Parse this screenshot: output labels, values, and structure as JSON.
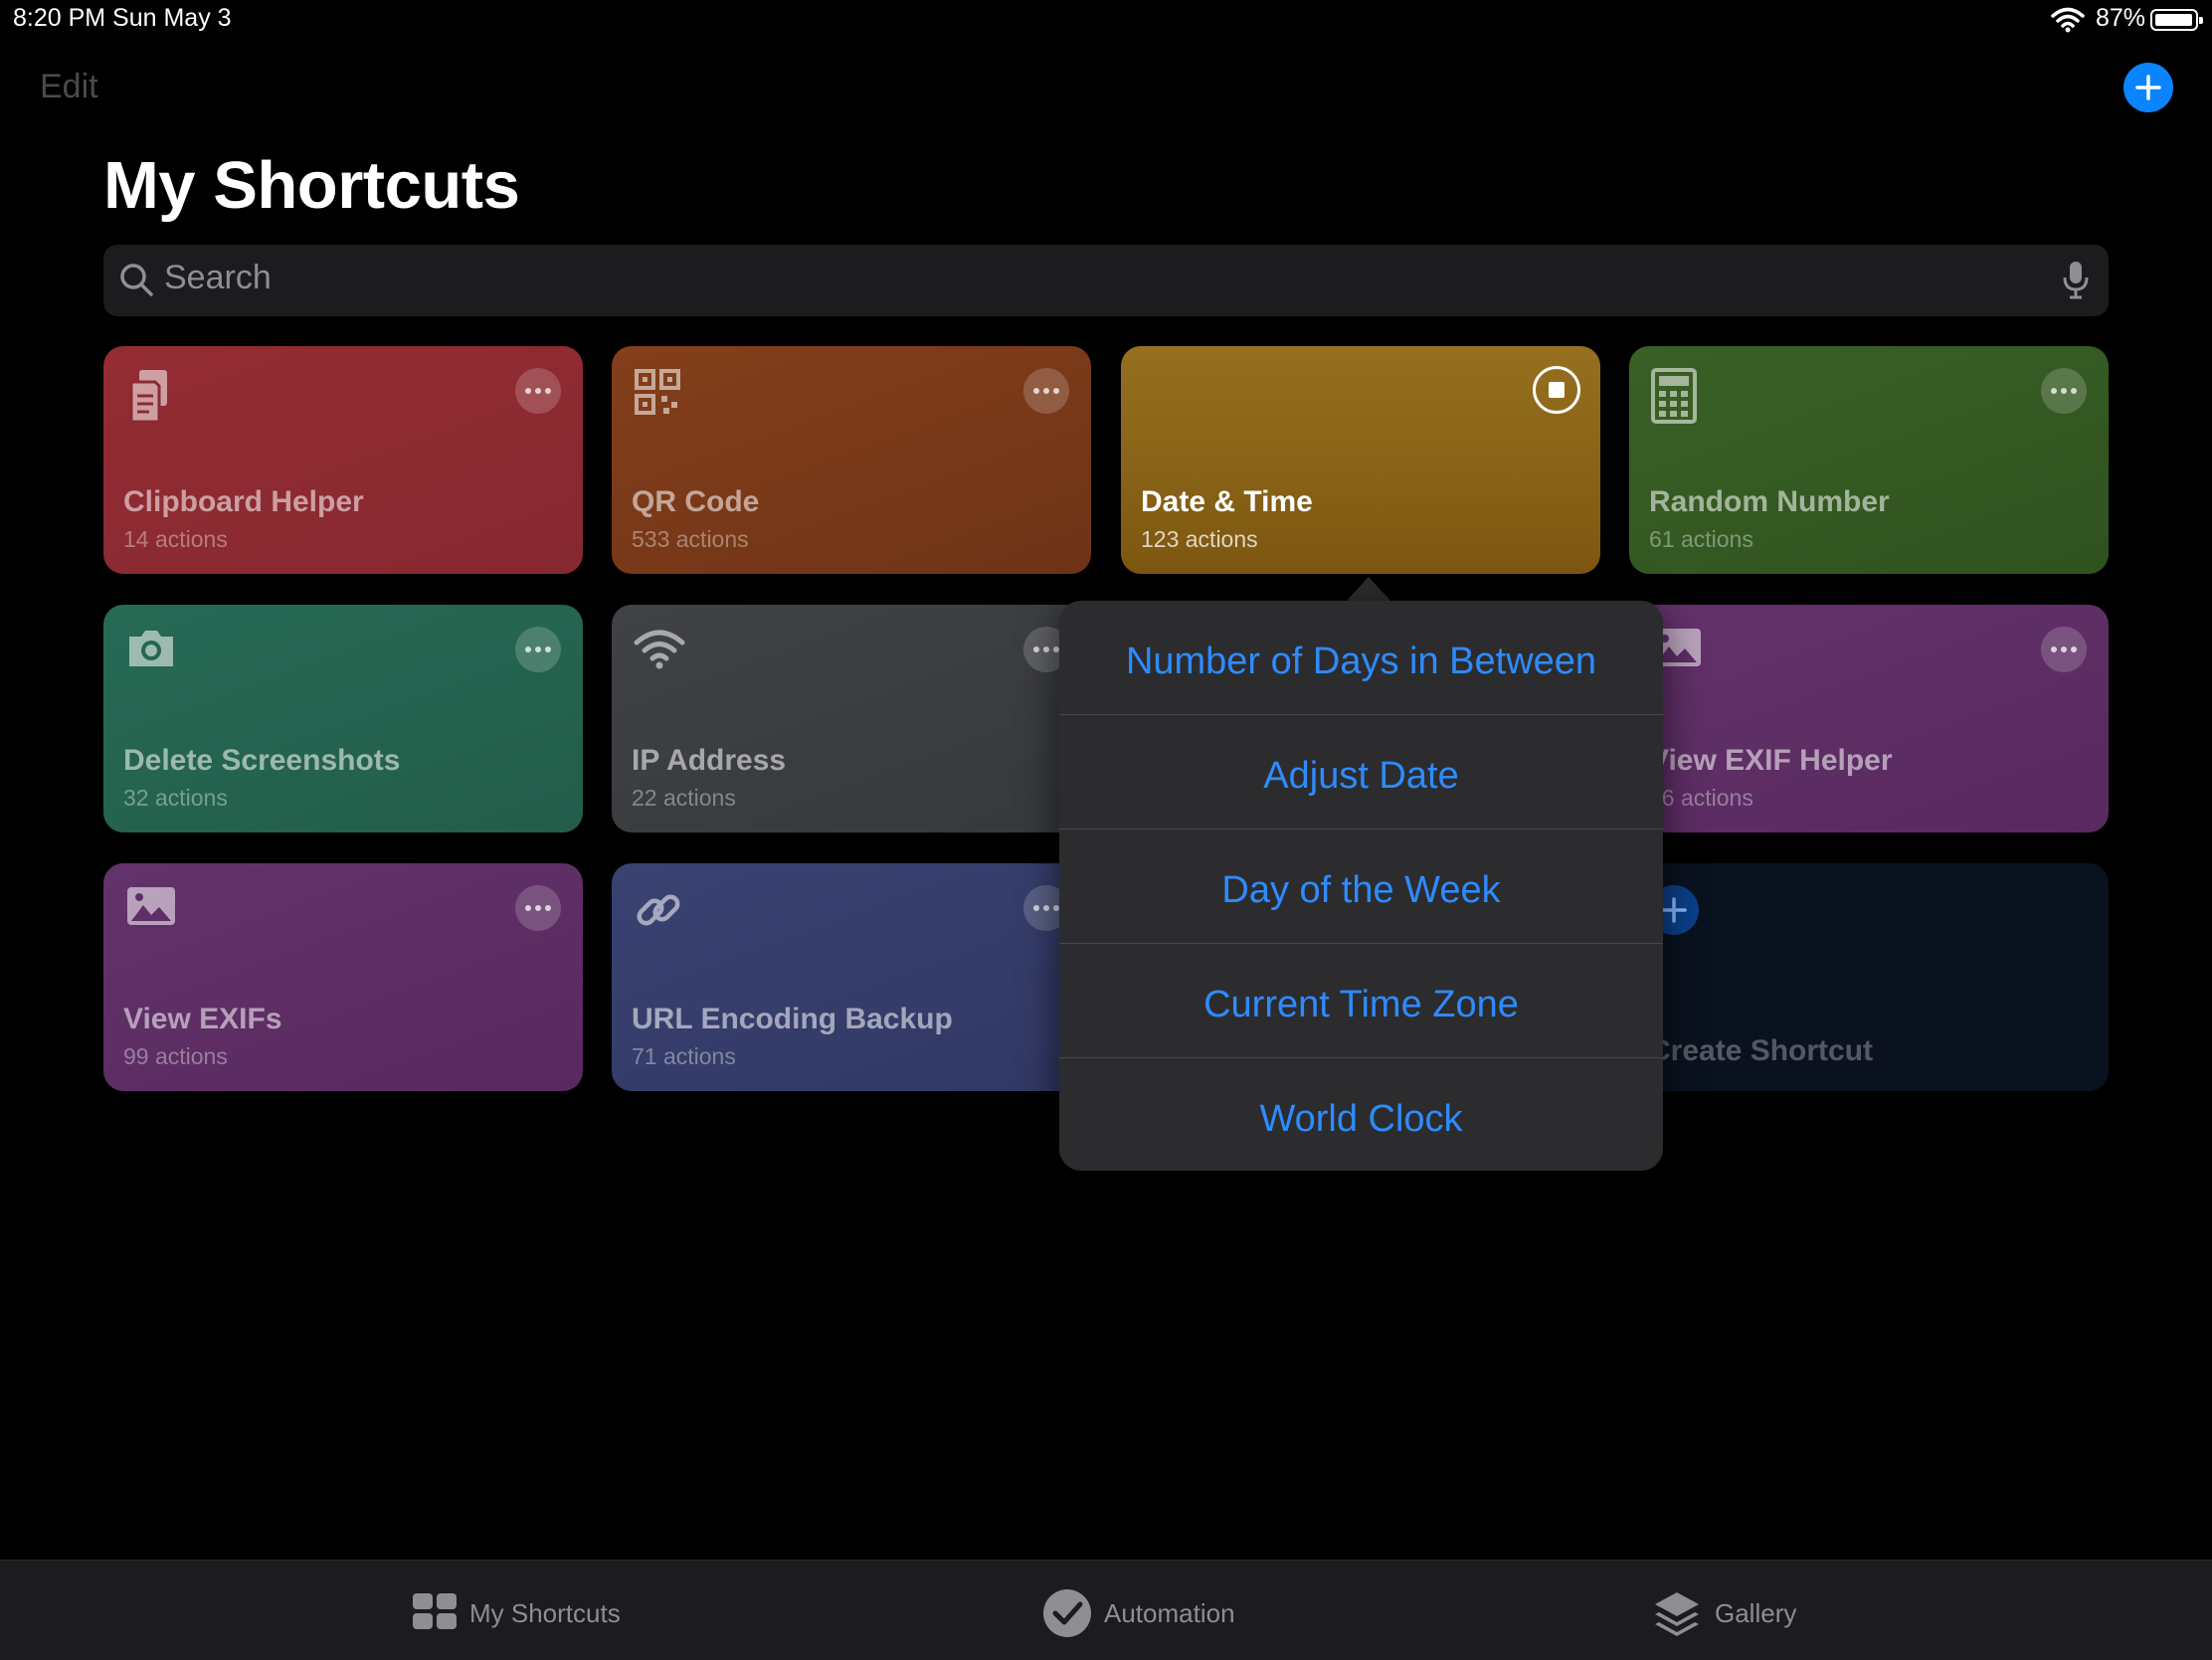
{
  "status_bar": {
    "time": "8:20 PM  Sun May 3",
    "battery": "87%"
  },
  "header": {
    "edit_label": "Edit",
    "title": "My Shortcuts"
  },
  "search": {
    "placeholder": "Search"
  },
  "shortcuts": [
    {
      "name": "Clipboard Helper",
      "count": "14 actions",
      "color": "#8e2a31",
      "icon": "clipboard-icon"
    },
    {
      "name": "QR Code",
      "count": "533 actions",
      "color": "#7a3a19",
      "icon": "qr-code-icon"
    },
    {
      "name": "Date & Time",
      "count": "123 actions",
      "color": "#8f6716",
      "icon": "",
      "running": true
    },
    {
      "name": "Random Number",
      "count": "61 actions",
      "color": "#355a22",
      "icon": "calculator-icon"
    },
    {
      "name": "Delete Screenshots",
      "count": "32 actions",
      "color": "#24604d",
      "icon": "camera-icon"
    },
    {
      "name": "IP Address",
      "count": "22 actions",
      "color": "#3c3e42",
      "icon": "wifi-icon"
    },
    {
      "name": "View EXIF Helper",
      "count": "66 actions",
      "color": "#5c2e64",
      "icon": "photo-icon"
    },
    {
      "name": "View EXIFs",
      "count": "99 actions",
      "color": "#5c2e64",
      "icon": "photo-icon"
    },
    {
      "name": "URL Encoding Backup",
      "count": "71 actions",
      "color": "#333b66",
      "icon": "link-icon"
    }
  ],
  "create_shortcut": {
    "label": "Create Shortcut"
  },
  "popover_menu": {
    "items": [
      "Number of Days in Between",
      "Adjust Date",
      "Day of the Week",
      "Current Time Zone",
      "World Clock"
    ]
  },
  "tab_bar": {
    "tabs": [
      {
        "label": "My Shortcuts",
        "icon": "grid-icon"
      },
      {
        "label": "Automation",
        "icon": "checkmark-circle-icon"
      },
      {
        "label": "Gallery",
        "icon": "layers-icon"
      }
    ]
  },
  "colors": {
    "accent": "#0a84ff",
    "menu_text": "#2e8bff"
  }
}
